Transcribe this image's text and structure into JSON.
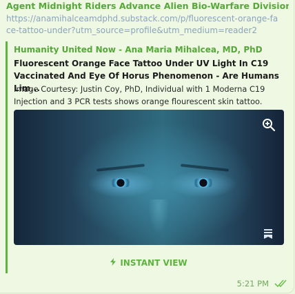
{
  "message": {
    "sender": "Agent Midnight Riders Advance Alien Bio-Warfare Division",
    "link_text": "https://anamihalceamdphd.substack.com/p/fluorescent-orange-face-tattoo-under?utm_source=profile&utm_medium=reader2",
    "time": "5:21 PM"
  },
  "preview": {
    "site_name": "Humanity United Now - Ana Maria Mihalcea, MD, PhD",
    "title": "Fluorescent Orange Face Tattoo Under UV Light In C19\nVaccinated And Eye Of Horus Phenomenon - Are Humans Lim...",
    "description": "Image Courtesy: Justin Coy, PhD, Individual with 1 Moderna C19\nInjection and 3 PCR tests shows orange flourescent skin tattoo.",
    "instant_view_label": "INSTANT VIEW"
  },
  "icons": {
    "zoom": "zoom-in-icon",
    "bookmark": "bookmark-icon",
    "instant_view": "lightning-icon",
    "read_receipt": "double-check-icon"
  },
  "colors": {
    "accent": "#5cb43e",
    "bubble_background": "#eef8e2",
    "link": "#8ba4bb"
  }
}
